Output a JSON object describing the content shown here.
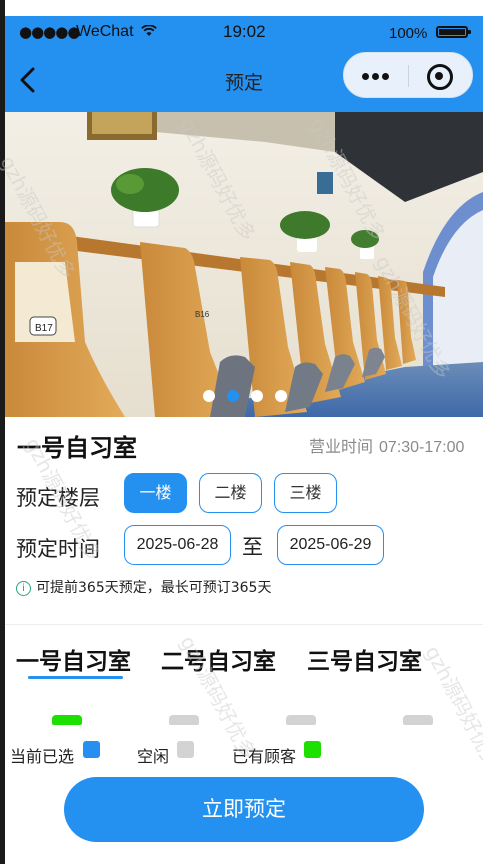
{
  "status_bar": {
    "signal": "●●●●●",
    "carrier": "WeChat",
    "time": "19:02",
    "battery": "100%"
  },
  "nav": {
    "title": "预定"
  },
  "banner": {
    "slides": 4,
    "active_slide": 2,
    "desk_tag_1": "B17",
    "desk_tag_2": "B16"
  },
  "room": {
    "name": "一号自习室",
    "hours_label": "营业时间",
    "hours_value": "07:30-17:00"
  },
  "floor": {
    "label": "预定楼层",
    "options": [
      "一楼",
      "二楼",
      "三楼"
    ],
    "selected": "一楼"
  },
  "time": {
    "label": "预定时间",
    "start": "2025-06-28",
    "separator": "至",
    "end": "2025-06-29"
  },
  "tip": {
    "icon": "info-icon",
    "icon_glyph": "i",
    "text": "可提前365天预定，最长可预订365天"
  },
  "tabs": {
    "items": [
      "一号自习室",
      "二号自习室",
      "三号自习室"
    ],
    "active": "一号自习室"
  },
  "seats": [
    {
      "status": "taken"
    },
    {
      "status": "free"
    },
    {
      "status": "free"
    },
    {
      "status": "free"
    }
  ],
  "legend": {
    "selected": "当前已选",
    "free": "空闲",
    "taken": "已有顾客"
  },
  "submit_label": "立即预定",
  "watermark": "gzh源码好优多",
  "colors": {
    "accent": "#2491f1",
    "free": "#d3d3d3",
    "taken": "#1de000"
  }
}
